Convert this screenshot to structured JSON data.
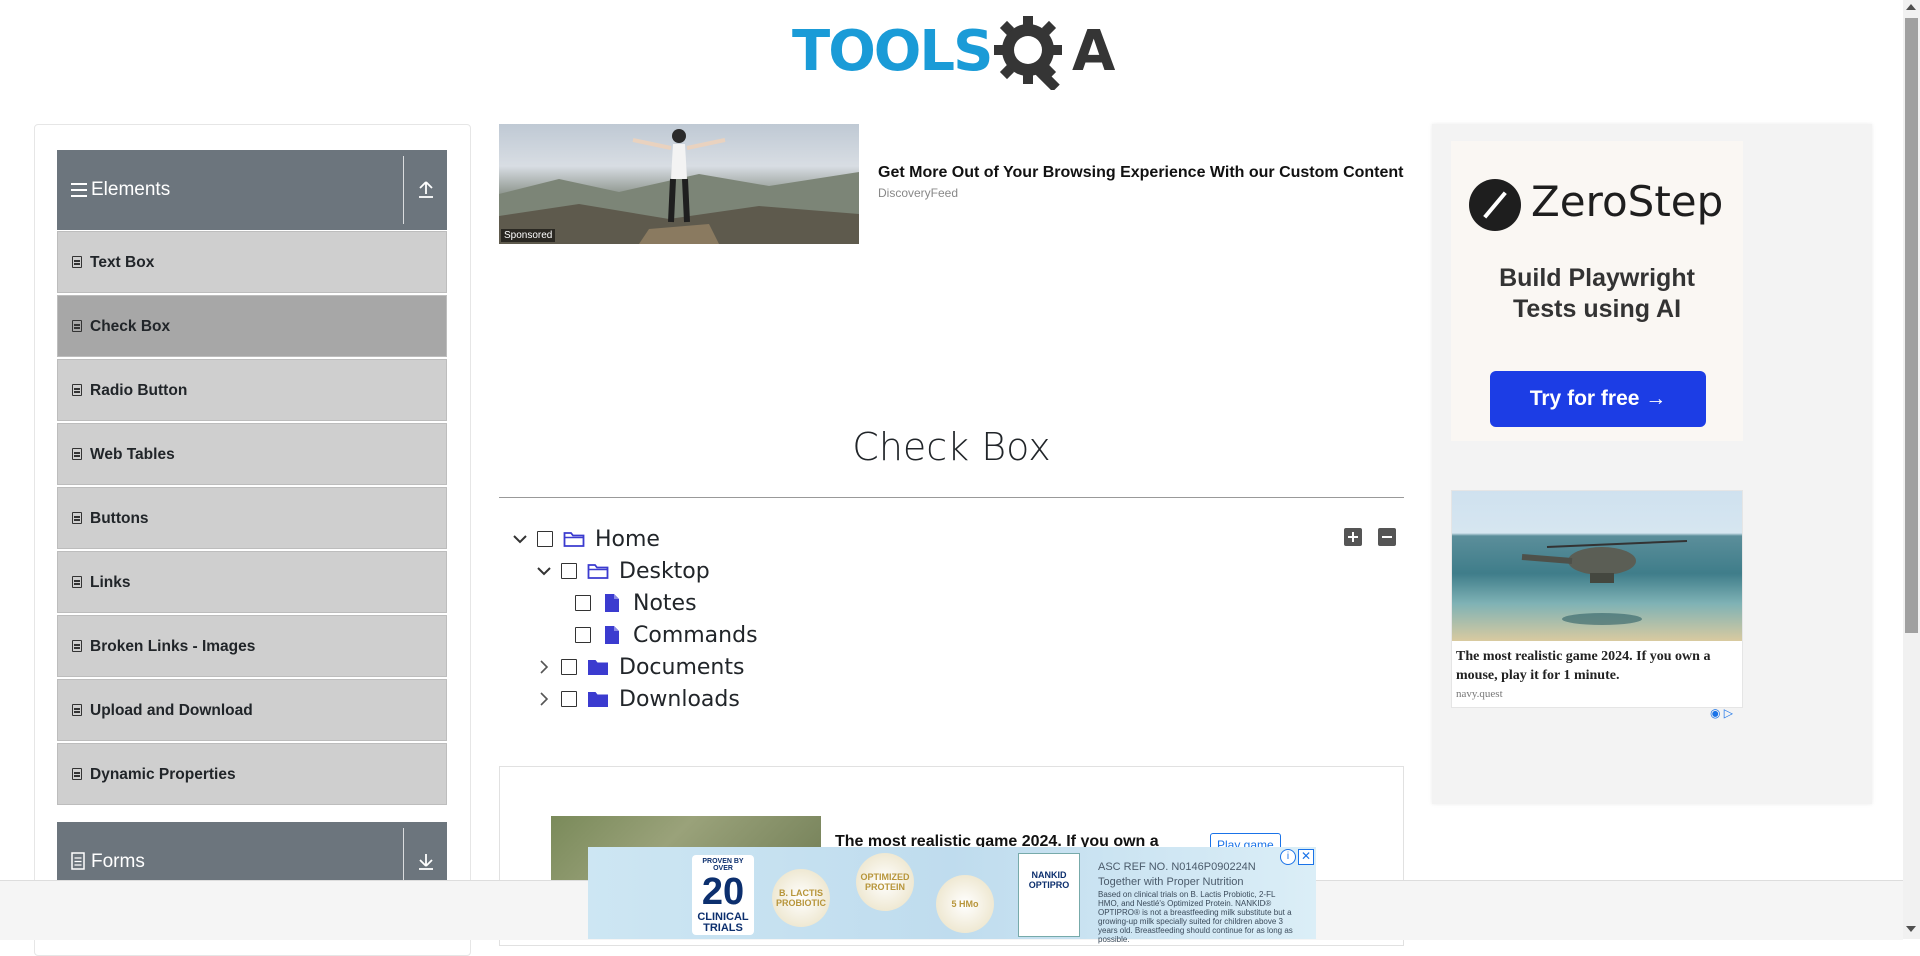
{
  "header": {
    "logo_text_left": "TOOLS",
    "logo_text_right": "A"
  },
  "sidebar": {
    "groups": [
      {
        "label": "Elements",
        "icon": "hamburger-icon",
        "arrow": "collapse-up-icon"
      },
      {
        "label": "Forms",
        "icon": "form-icon",
        "arrow": "expand-down-icon"
      }
    ],
    "items": [
      {
        "label": "Text Box"
      },
      {
        "label": "Check Box",
        "active": true
      },
      {
        "label": "Radio Button"
      },
      {
        "label": "Web Tables"
      },
      {
        "label": "Buttons"
      },
      {
        "label": "Links"
      },
      {
        "label": "Broken Links - Images"
      },
      {
        "label": "Upload and Download"
      },
      {
        "label": "Dynamic Properties"
      }
    ]
  },
  "top_ad": {
    "sponsored": "Sponsored",
    "headline": "Get More Out of Your Browsing Experience With our Custom Content",
    "source": "DiscoveryFeed"
  },
  "main": {
    "title": "Check Box",
    "tree": [
      {
        "label": "Home",
        "expanded": true,
        "icon": "folder-open-icon"
      },
      {
        "label": "Desktop",
        "expanded": true,
        "icon": "folder-open-icon"
      },
      {
        "label": "Notes",
        "icon": "file-icon"
      },
      {
        "label": "Commands",
        "icon": "file-icon"
      },
      {
        "label": "Documents",
        "expanded": false,
        "icon": "folder-closed-icon"
      },
      {
        "label": "Downloads",
        "expanded": false,
        "icon": "folder-closed-icon"
      }
    ],
    "expand_all_icon": "plus-square-icon",
    "collapse_all_icon": "minus-square-icon"
  },
  "bottom_card": {
    "text": "The most realistic game 2024. If you own a",
    "button": "Play game"
  },
  "right_ad": {
    "brand": "ZeroStep",
    "tagline_line1": "Build Playwright",
    "tagline_line2": "Tests using AI",
    "cta": "Try for free →",
    "heli_text": "The most realistic game 2024. If you own a mouse, play it for 1 minute.",
    "heli_source": "navy.quest"
  },
  "fixed_ad": {
    "badge_top": "PROVEN BY OVER",
    "badge_number": "20",
    "badge_bottom": "CLINICAL TRIALS",
    "bubbles": [
      "B. LACTIS PROBIOTIC",
      "OPTIMIZED PROTEIN",
      "5 HMo"
    ],
    "product": "NANKID OPTIPRO",
    "ref": "ASC REF NO. N0146P090224N",
    "tagline": "Together with Proper Nutrition",
    "fine_print": "Based on clinical trials on B. Lactis Probiotic, 2-FL HMO, and Nestlé's Optimized Protein. NANKID® OPTIPRO® is not a breastfeeding milk substitute but a growing-up milk specially suited for children above 3 years old. Breastfeeding should continue for as long as possible."
  },
  "colors": {
    "logo_blue": "#1a9bd7",
    "group_header": "#6c757d",
    "menu_item_bg": "#cfcfcf",
    "menu_item_active": "#a7a7a7",
    "tree_folder": "#3b3bcf",
    "zerostep_button": "#1c3de5"
  }
}
